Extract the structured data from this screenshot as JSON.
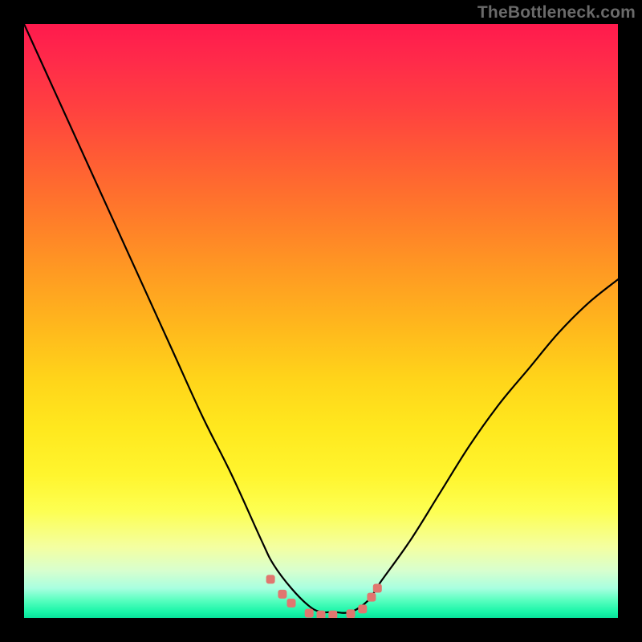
{
  "watermark": "TheBottleneck.com",
  "colors": {
    "curve_stroke": "#000000",
    "markers_fill": "#e0766f",
    "background_frame": "#000000"
  },
  "chart_data": {
    "type": "line",
    "title": "",
    "xlabel": "",
    "ylabel": "",
    "xlim": [
      0,
      100
    ],
    "ylim": [
      0,
      100
    ],
    "grid": false,
    "legend": false,
    "annotations": [],
    "series": [
      {
        "name": "bottleneck-curve",
        "x": [
          0,
          5,
          10,
          15,
          20,
          25,
          30,
          35,
          40,
          42,
          45,
          48,
          50,
          52,
          55,
          58,
          60,
          65,
          70,
          75,
          80,
          85,
          90,
          95,
          100
        ],
        "y": [
          100,
          89,
          78,
          67,
          56,
          45,
          34,
          24,
          13,
          9,
          5,
          2,
          1,
          1,
          1,
          3,
          6,
          13,
          21,
          29,
          36,
          42,
          48,
          53,
          57
        ]
      }
    ],
    "markers": {
      "name": "near-zero-markers",
      "x": [
        41.5,
        43.5,
        45,
        48,
        50,
        52,
        55,
        57,
        58.5,
        59.5
      ],
      "y": [
        6.5,
        4,
        2.5,
        0.8,
        0.5,
        0.5,
        0.7,
        1.5,
        3.5,
        5
      ]
    }
  }
}
